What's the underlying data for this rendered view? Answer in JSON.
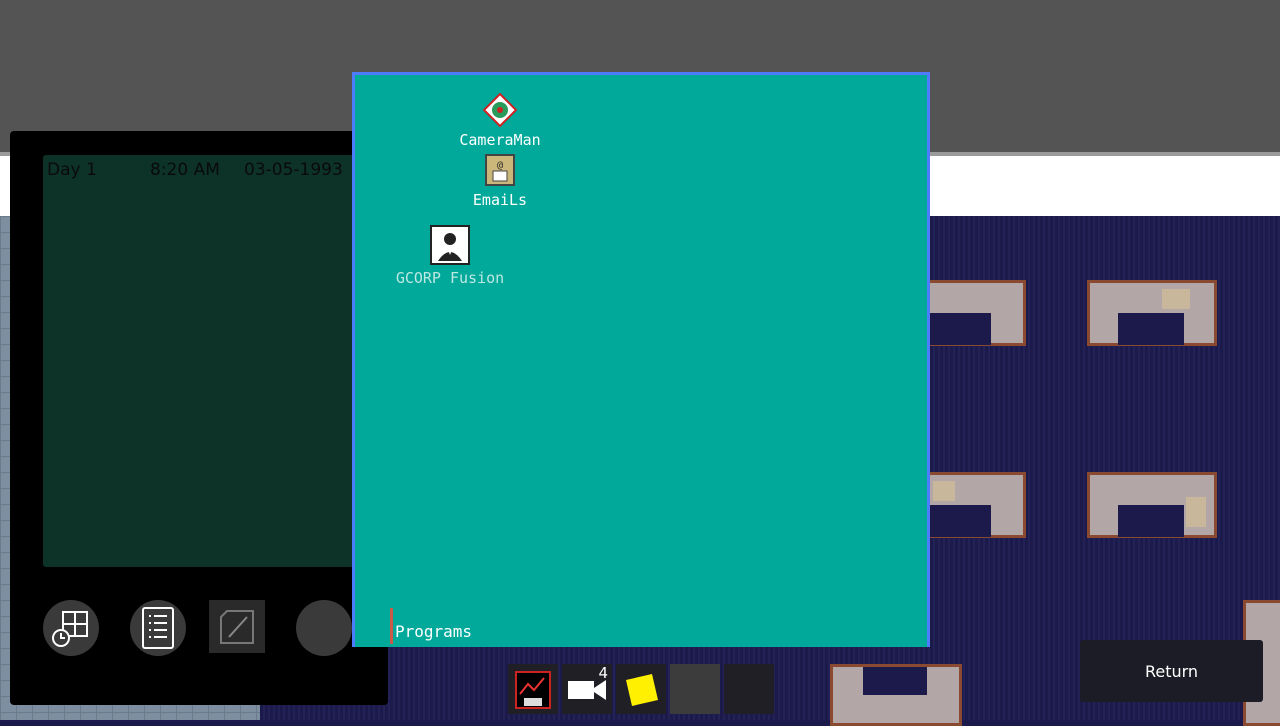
{
  "pda": {
    "day": "Day 1",
    "time": "8:20 AM",
    "date": "03-05-1993",
    "buttons": [
      "apps-clock-icon",
      "document-list-icon",
      "notepad-edit-icon",
      "blank-circle-icon"
    ]
  },
  "desktop": {
    "icons": [
      {
        "label": "CameraMan",
        "icon": "cameraman-icon"
      },
      {
        "label": "EmaiLs",
        "icon": "email-icon"
      },
      {
        "label": "GCORP Fusion",
        "icon": "user-profile-icon"
      }
    ],
    "taskbar_label": "Programs"
  },
  "hotbar": {
    "camera_count": "4",
    "slots": [
      "chart-disk-icon",
      "camera-icon",
      "sticky-note-icon",
      "empty-slot",
      "empty-slot"
    ]
  },
  "return_label": "Return",
  "colors": {
    "desktop": "#00a99a",
    "window_border": "#4d7cff",
    "pda_screen": "#0d3328"
  }
}
